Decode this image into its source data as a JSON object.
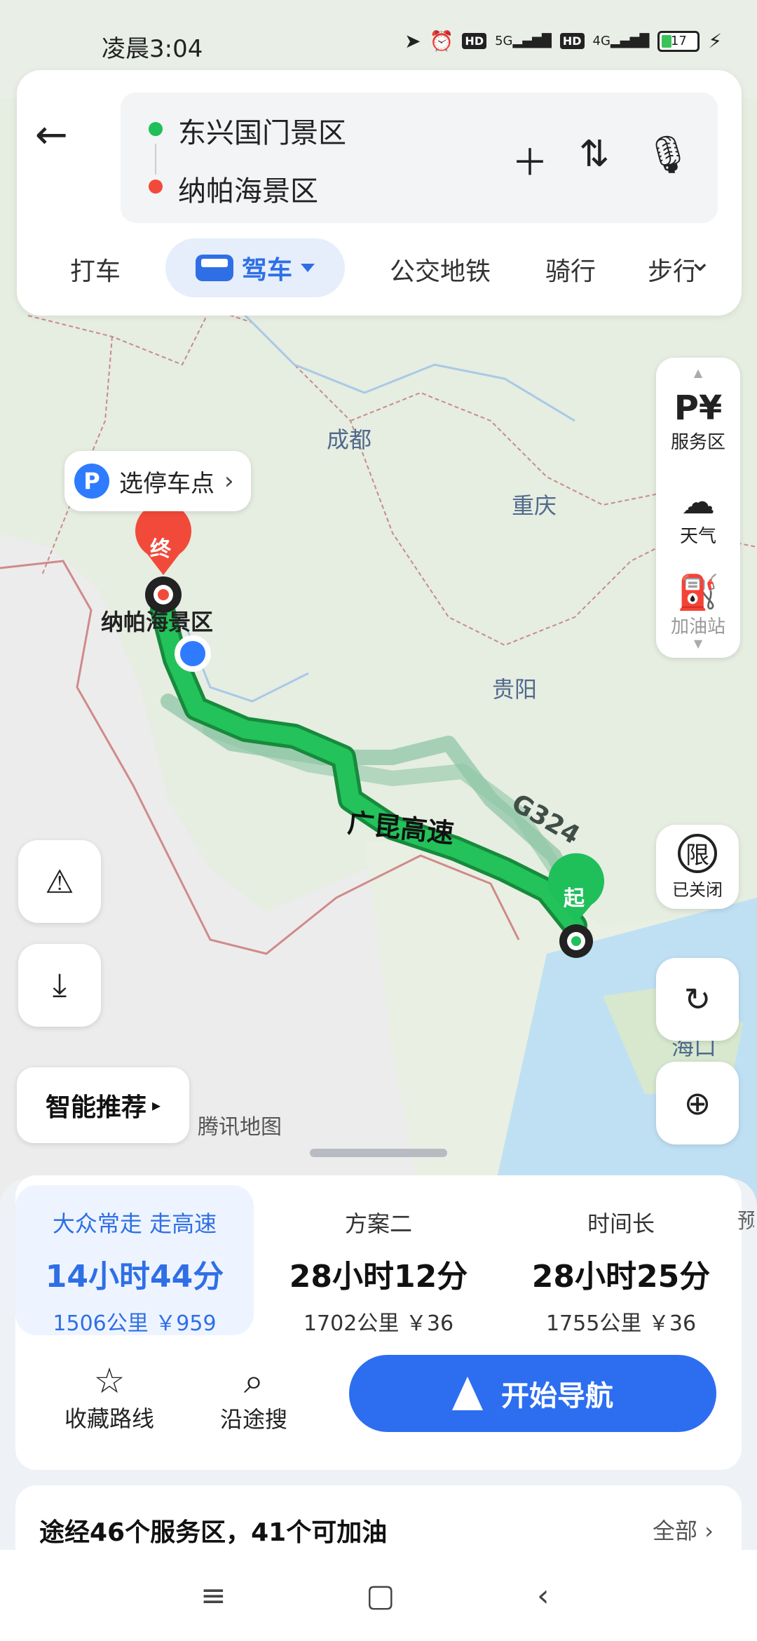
{
  "status": {
    "time": "凌晨3:04",
    "net1": "5G",
    "net2": "4G",
    "hd": "HD",
    "battery": "17"
  },
  "route": {
    "start": "东兴国门景区",
    "end": "纳帕海景区"
  },
  "modes": [
    "打车",
    "驾车",
    "公交地铁",
    "骑行",
    "步行"
  ],
  "map": {
    "labels": {
      "chengdu": "成都",
      "chongqing": "重庆",
      "guiyang": "贵阳",
      "haikou": "海口"
    },
    "end_marker": "终",
    "start_marker": "起",
    "end_place": "纳帕海景区",
    "road_main": "广昆高速",
    "road_alt": "G324",
    "parking_label": "选停车点",
    "parking_badge": "P",
    "watermark": "腾讯地图",
    "smart": "智能推荐"
  },
  "right_tools": {
    "service": "服务区",
    "weather": "天气",
    "fuel": "加油站",
    "restrict": "已关闭",
    "restrict_icon": "限"
  },
  "routes": [
    {
      "tag": "大众常走 走高速",
      "duration": "14小时44分",
      "meta": "1506公里 ￥959"
    },
    {
      "tag": "方案二",
      "duration": "28小时12分",
      "meta": "1702公里 ￥36"
    },
    {
      "tag": "时间长",
      "duration": "28小时25分",
      "meta": "1755公里 ￥36"
    }
  ],
  "route_edge": "预",
  "actions": {
    "favorite": "收藏路线",
    "search_along": "沿途搜",
    "start_nav": "开始导航"
  },
  "service_bar": {
    "text": "途经46个服务区，41个可加油",
    "all": "全部"
  },
  "colors": {
    "accent": "#2d6ef0",
    "route_green": "#1fbf5a",
    "start_green": "#1fbf5a",
    "end_red": "#f24a3a"
  }
}
